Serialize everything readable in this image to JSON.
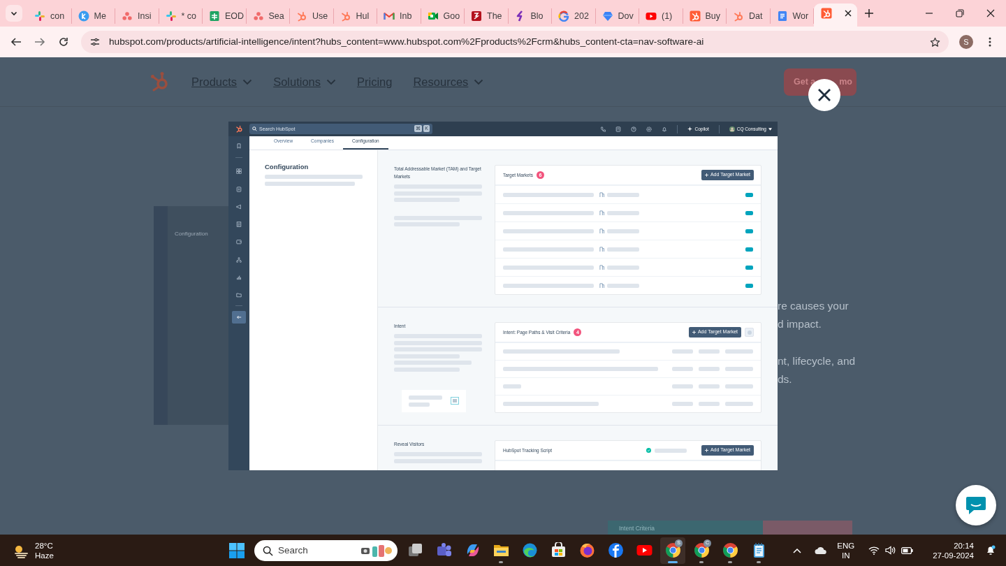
{
  "browser": {
    "tabs": [
      {
        "label": "con",
        "kind": "pinwheel",
        "selected": false
      },
      {
        "label": "Me",
        "kind": "circle",
        "selected": false
      },
      {
        "label": "Insi",
        "kind": "dots",
        "selected": false
      },
      {
        "label": "* co",
        "kind": "pinwheel",
        "selected": false
      },
      {
        "label": "EOD",
        "kind": "sheet",
        "selected": false
      },
      {
        "label": "Sea",
        "kind": "dots",
        "selected": false
      },
      {
        "label": "Use",
        "kind": "sprocket",
        "selected": false
      },
      {
        "label": "Hul",
        "kind": "sprocket",
        "selected": false
      },
      {
        "label": "Inb",
        "kind": "envelope",
        "selected": false
      },
      {
        "label": "Goo",
        "kind": "camera",
        "selected": false
      },
      {
        "label": "The",
        "kind": "square",
        "selected": false
      },
      {
        "label": "Blo",
        "kind": "bolt",
        "selected": false
      },
      {
        "label": "202",
        "kind": "ring",
        "selected": false
      },
      {
        "label": "Dov",
        "kind": "heart",
        "selected": false
      },
      {
        "label": "(1)",
        "kind": "play",
        "selected": false
      },
      {
        "label": "Buy",
        "kind": "sprocketbox",
        "selected": false
      },
      {
        "label": "Dat",
        "kind": "sprocket",
        "selected": false
      },
      {
        "label": "Wor",
        "kind": "doc",
        "selected": false
      },
      {
        "kind": "sprocketbox",
        "selected": true
      }
    ],
    "url": "hubspot.com/products/artificial-intelligence/intent?hubs_content=www.hubspot.com%2Fproducts%2Fcrm&hubs_content-cta=nav-software-ai",
    "profile": "S"
  },
  "site_nav": {
    "items": [
      {
        "label": "Products",
        "dropdown": true
      },
      {
        "label": "Solutions",
        "dropdown": true
      },
      {
        "label": "Pricing",
        "dropdown": false
      },
      {
        "label": "Resources",
        "dropdown": true
      }
    ],
    "cta": {
      "visible_start": "Get a",
      "visible_end": "mo"
    }
  },
  "background": {
    "preview_title": "Configuration",
    "text_lines": [
      "re causes your",
      "d impact.",
      "nt, lifecycle, and",
      "ds."
    ],
    "strip_label": "Intent Criteria"
  },
  "app": {
    "search_placeholder": "Search HubSpot",
    "shortcut_keys": [
      "⌘",
      "K"
    ],
    "copilot": "Copilot",
    "account": "CQ Consulting",
    "sidebar": [
      {
        "kind": "bookmark",
        "selected": false
      },
      {
        "kind": "grid",
        "selected": false
      },
      {
        "kind": "card",
        "selected": false
      },
      {
        "kind": "megaphone",
        "selected": false
      },
      {
        "kind": "document",
        "selected": false
      },
      {
        "kind": "wallet",
        "selected": false
      },
      {
        "kind": "hierarchy",
        "selected": false
      },
      {
        "kind": "chart",
        "selected": false
      },
      {
        "kind": "folder",
        "selected": false
      },
      {
        "kind": "arrow",
        "selected": true
      }
    ],
    "tabs": [
      {
        "label": "Overview",
        "selected": false
      },
      {
        "label": "Companies",
        "selected": false
      },
      {
        "label": "Configuration",
        "selected": true
      }
    ],
    "panel_title": "Configuration",
    "sections": [
      {
        "label": "Total Addressable Market (TAM) and Target Markets",
        "card": {
          "kind": "markets",
          "title": "Target Markets",
          "count": "6",
          "button": "Add Target Market"
        }
      },
      {
        "label": "Intent",
        "card": {
          "kind": "intent",
          "title": "Intent: Page Paths & Visit Criteria",
          "count": "4",
          "button": "Add Target Market"
        }
      },
      {
        "label": "Reveal Visitors",
        "card": {
          "kind": "tracking",
          "title": "HubSpot Tracking Script",
          "button": "Add Target Market",
          "verified": true
        }
      }
    ]
  },
  "taskbar": {
    "weather": {
      "temp": "28°C",
      "condition": "Haze"
    },
    "search_placeholder": "Search",
    "apps": [
      {
        "kind": "taskview",
        "running": false,
        "selected": false
      },
      {
        "kind": "teams",
        "running": false,
        "selected": false
      },
      {
        "kind": "copilot",
        "running": false,
        "selected": false
      },
      {
        "kind": "explorer",
        "running": true,
        "selected": false
      },
      {
        "kind": "edge",
        "running": false,
        "selected": false
      },
      {
        "kind": "store",
        "running": false,
        "selected": false
      },
      {
        "kind": "firefox",
        "running": false,
        "selected": false
      },
      {
        "kind": "facebook",
        "running": false,
        "selected": false
      },
      {
        "kind": "youtube",
        "running": false,
        "selected": false
      },
      {
        "kind": "chrome",
        "badge": "S",
        "running": true,
        "selected": true
      },
      {
        "kind": "chrome",
        "badge": "C",
        "running": true,
        "selected": false
      },
      {
        "kind": "chrome",
        "running": true,
        "selected": false
      },
      {
        "kind": "notepad",
        "running": true,
        "selected": false
      }
    ],
    "tray": {
      "language": "ENG",
      "region": "IN",
      "time": "20:14",
      "date": "27-09-2024"
    }
  }
}
